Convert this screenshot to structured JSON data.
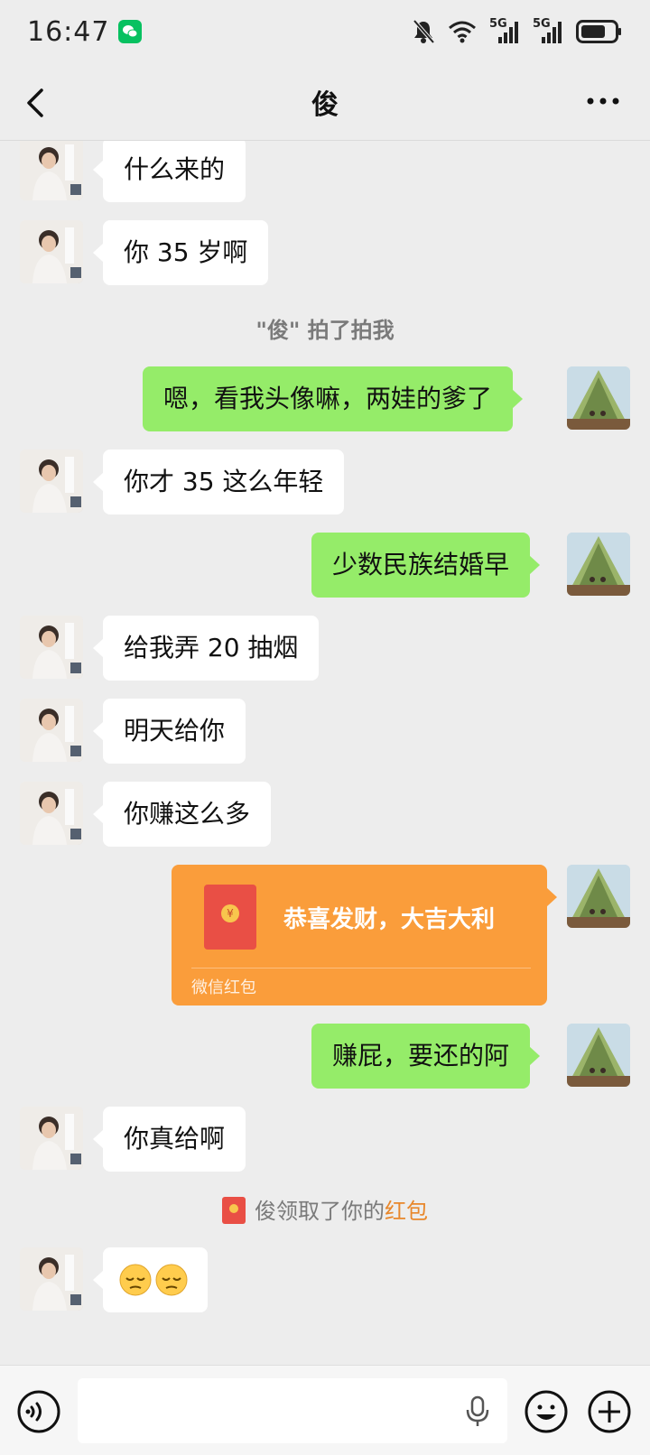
{
  "status_bar": {
    "time": "16:47",
    "network_label_1": "5G",
    "network_label_2": "5G"
  },
  "header": {
    "title": "俊"
  },
  "messages": [
    {
      "side": "in",
      "text": "什么来的"
    },
    {
      "side": "in",
      "text": "你 35 岁啊"
    },
    {
      "side": "system",
      "prefix": "\"俊\"",
      "text": " 拍了拍我"
    },
    {
      "side": "out",
      "text": "嗯，看我头像嘛，两娃的爹了"
    },
    {
      "side": "in",
      "text": "你才 35 这么年轻"
    },
    {
      "side": "out",
      "text": "少数民族结婚早"
    },
    {
      "side": "in",
      "text": "给我弄 20 抽烟"
    },
    {
      "side": "in",
      "text": "明天给你"
    },
    {
      "side": "in",
      "text": "你赚这么多"
    },
    {
      "side": "out",
      "type": "red_packet",
      "title": "恭喜发财，大吉大利",
      "label": "微信红包"
    },
    {
      "side": "out",
      "text": "赚屁，要还的阿"
    },
    {
      "side": "in",
      "text": "你真给啊"
    },
    {
      "side": "system",
      "text": "俊领取了你的",
      "highlight": "红包"
    },
    {
      "side": "in",
      "text": "😔😔"
    }
  ],
  "input": {
    "value": "",
    "placeholder": ""
  },
  "colors": {
    "background": "#ededed",
    "incoming_bubble": "#ffffff",
    "outgoing_bubble": "#95ec69",
    "red_packet": "#fa9d3b",
    "highlight": "#e8872b",
    "wechat_green": "#07c160"
  },
  "icons": {
    "back": "chevron-left-icon",
    "more": "more-dots-icon",
    "voice": "voice-icon",
    "mic": "mic-icon",
    "emoji": "emoji-icon",
    "plus": "plus-icon"
  }
}
